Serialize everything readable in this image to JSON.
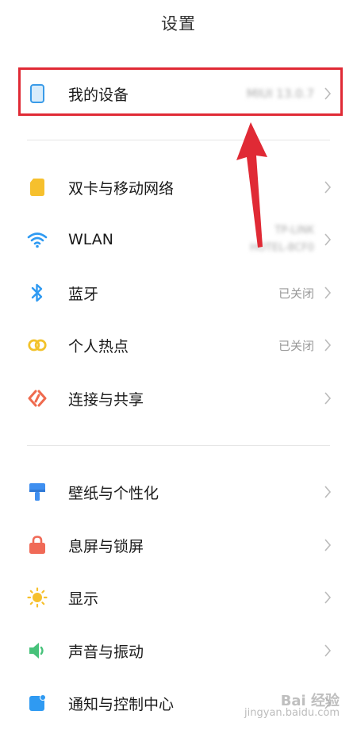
{
  "header": {
    "title": "设置"
  },
  "rows": {
    "my_device": {
      "label": "我的设备",
      "value": "MIUI 13.0.7"
    },
    "dual_sim": {
      "label": "双卡与移动网络"
    },
    "wlan": {
      "label": "WLAN",
      "value_line1": "TP-LINK",
      "value_line2": "HOTEL-8CF0"
    },
    "bluetooth": {
      "label": "蓝牙",
      "value": "已关闭"
    },
    "hotspot": {
      "label": "个人热点",
      "value": "已关闭"
    },
    "connect_share": {
      "label": "连接与共享"
    },
    "wallpaper": {
      "label": "壁纸与个性化"
    },
    "lock_screen": {
      "label": "息屏与锁屏"
    },
    "display": {
      "label": "显示"
    },
    "sound": {
      "label": "声音与振动"
    },
    "notify": {
      "label": "通知与控制中心"
    }
  },
  "icons": {
    "my_device": "phone-icon",
    "dual_sim": "sim-card-icon",
    "wlan": "wifi-icon",
    "bluetooth": "bluetooth-icon",
    "hotspot": "hotspot-icon",
    "connect_share": "connect-share-icon",
    "wallpaper": "brush-icon",
    "lock_screen": "lock-icon",
    "display": "sun-icon",
    "sound": "speaker-icon",
    "notify": "notification-icon"
  },
  "colors": {
    "highlight_border": "#e02a35",
    "arrow": "#e02a35",
    "sim": "#f6c02d",
    "wifi": "#2f9af2",
    "bluetooth": "#2f9af2",
    "hotspot": "#f2c22b",
    "connect": "#ef6a4e",
    "brush": "#3f8ff0",
    "lock": "#f06a57",
    "sun": "#f6c02d",
    "sound": "#47c27a",
    "notify": "#2f9af2"
  },
  "watermark": {
    "brand": "Bai 经验",
    "url": "jingyan.baidu.com"
  }
}
